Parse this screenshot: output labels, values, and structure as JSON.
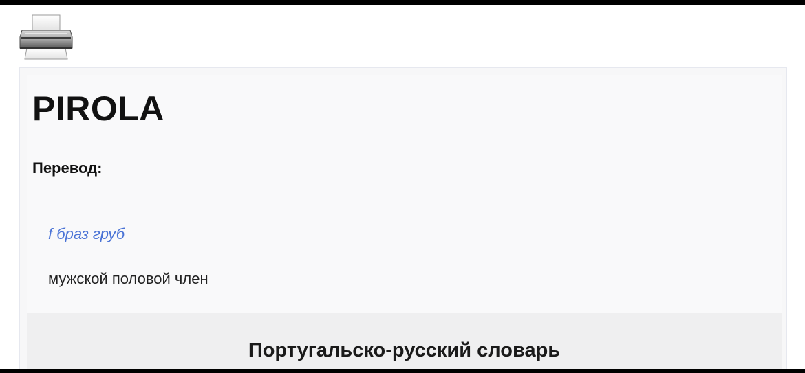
{
  "toolbar": {
    "print_icon": "printer-icon"
  },
  "entry": {
    "headword": "PIROLA",
    "translation_label": "Перевод:",
    "grammar": "f браз груб",
    "translation": "мужской половой член"
  },
  "dictionary": {
    "title": "Португальско-русский словарь"
  },
  "colors": {
    "grammar_link": "#4a73d6",
    "card_background": "#f7f7f8",
    "card_border": "#e6e8ef",
    "footer_band": "#efeff0"
  }
}
